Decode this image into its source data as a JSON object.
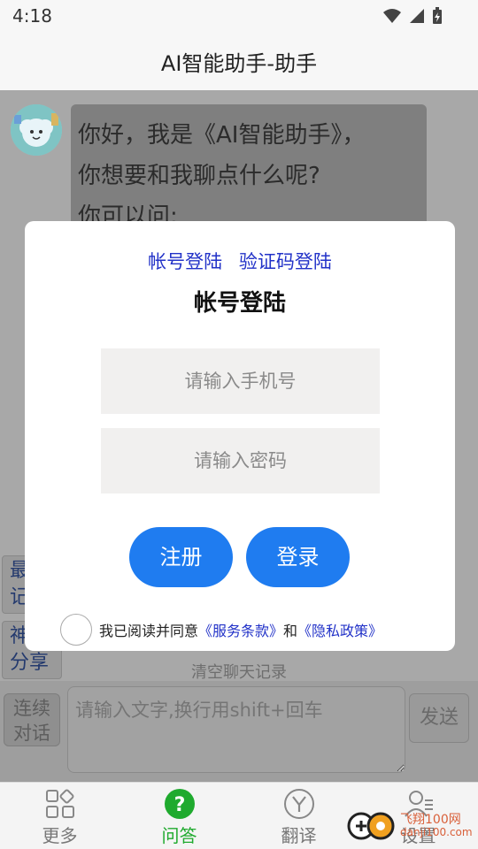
{
  "status": {
    "time": "4:18"
  },
  "header": {
    "title": "AI智能助手-助手"
  },
  "chat": {
    "greeting_lines": [
      "你好，我是《AI智能助手》，",
      "你想要和我聊点什么呢?",
      "你可以问:"
    ],
    "side_buttons": [
      "最\n记",
      "神\n分享"
    ],
    "clear_label": "清空聊天记录"
  },
  "input_bar": {
    "continue_label": "连续\n对话",
    "placeholder": "请输入文字,换行用shift+回车",
    "send_label": "发送"
  },
  "login_modal": {
    "tab_account": "帐号登陆",
    "tab_code": "验证码登陆",
    "title": "帐号登陆",
    "phone_placeholder": "请输入手机号",
    "password_placeholder": "请输入密码",
    "register_label": "注册",
    "login_label": "登录",
    "agree_prefix": "我已阅读并同意",
    "terms_link": "《服务条款》",
    "and_text": "和",
    "privacy_link": "《隐私政策》"
  },
  "bottom_nav": {
    "items": [
      {
        "label": "更多",
        "icon": "grid-icon"
      },
      {
        "label": "问答",
        "icon": "question-icon"
      },
      {
        "label": "翻译",
        "icon": "translate-icon"
      },
      {
        "label": "设置",
        "icon": "user-settings-icon"
      }
    ],
    "active_index": 1
  },
  "watermark": {
    "text_top": "飞翔100网",
    "text_bottom": "danji100.com"
  },
  "colors": {
    "accent_blue": "#1f7cf0",
    "link_blue": "#2232c8",
    "active_green": "#1faa2e"
  }
}
